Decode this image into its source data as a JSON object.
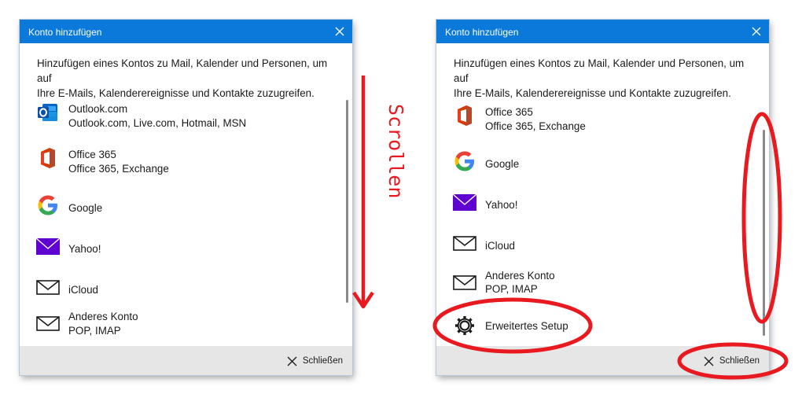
{
  "dialog": {
    "title": "Konto hinzufügen",
    "intro_line1": "Hinzufügen eines Kontos zu Mail, Kalender und Personen, um auf",
    "intro_line2": "Ihre E-Mails, Kalenderereignisse und Kontakte zuzugreifen.",
    "close_label": "Schließen"
  },
  "left_accounts": [
    {
      "name": "Outlook.com",
      "detail": "Outlook.com, Live.com, Hotmail, MSN",
      "icon": "outlook-icon"
    },
    {
      "name": "Office 365",
      "detail": "Office 365, Exchange",
      "icon": "office365-icon"
    },
    {
      "name": "Google",
      "detail": "",
      "icon": "google-icon"
    },
    {
      "name": "Yahoo!",
      "detail": "",
      "icon": "yahoo-icon"
    },
    {
      "name": "iCloud",
      "detail": "",
      "icon": "envelope-icon"
    },
    {
      "name": "Anderes Konto",
      "detail": "POP, IMAP",
      "icon": "envelope-icon"
    }
  ],
  "right_accounts": [
    {
      "name": "Office 365",
      "detail": "Office 365, Exchange",
      "icon": "office365-icon"
    },
    {
      "name": "Google",
      "detail": "",
      "icon": "google-icon"
    },
    {
      "name": "Yahoo!",
      "detail": "",
      "icon": "yahoo-icon"
    },
    {
      "name": "iCloud",
      "detail": "",
      "icon": "envelope-icon"
    },
    {
      "name": "Anderes Konto",
      "detail": "POP, IMAP",
      "icon": "envelope-icon"
    },
    {
      "name": "Erweitertes Setup",
      "detail": "",
      "icon": "gear-icon"
    }
  ],
  "annotation": {
    "scroll_label": "Scrollen",
    "color": "#e8191f"
  },
  "colors": {
    "titlebar": "#0a79d9",
    "footer": "#e6e6e6",
    "yahoo": "#5f01d1",
    "office": "#d83b01"
  }
}
